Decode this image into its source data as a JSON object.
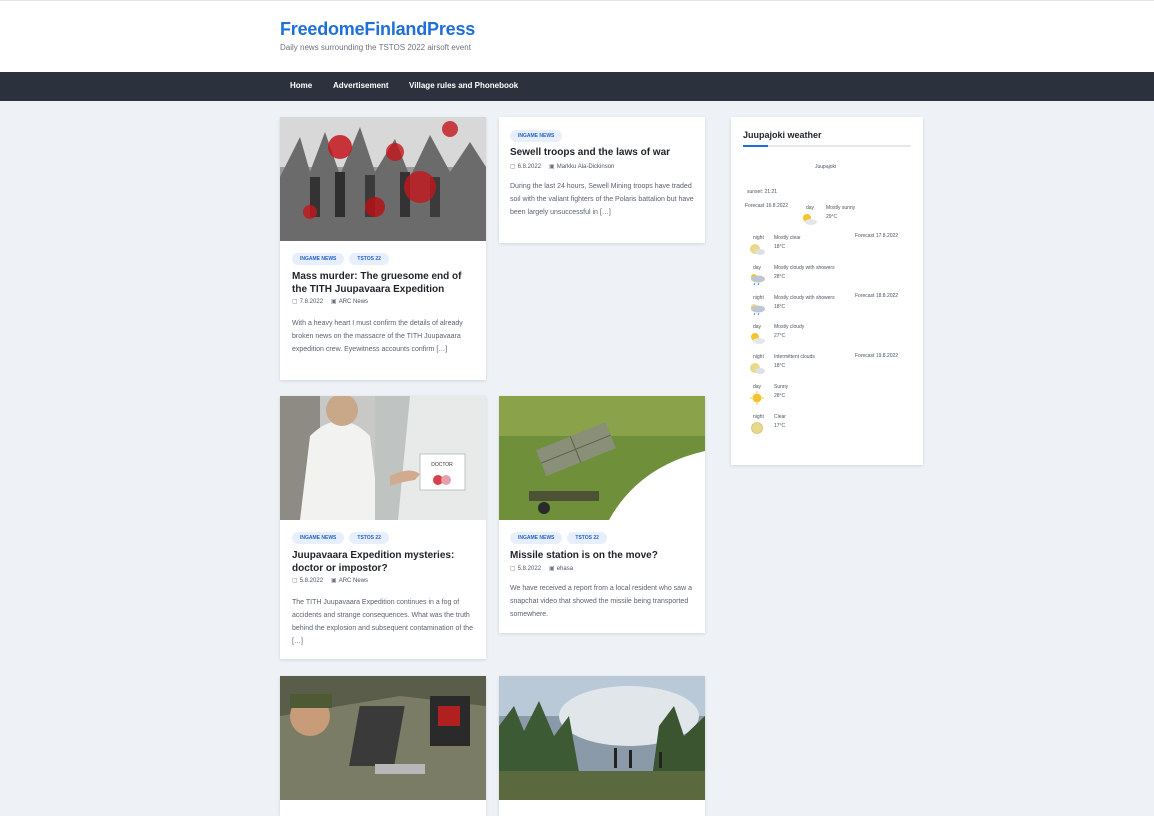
{
  "site": {
    "title": "FreedomeFinlandPress",
    "description": "Daily news surrounding the TSTOS 2022 airsoft event"
  },
  "menu": [
    "Home",
    "Advertisement",
    "Village rules and Phonebook"
  ],
  "posts": [
    {
      "tags": [
        "INGAME NEWS",
        "TSTOS 22"
      ],
      "title": "Mass murder: The gruesome end of the TITH Juupavaara Expedition",
      "date": "7.8.2022",
      "author": "ARC News",
      "excerpt": "With a heavy heart I must confirm the details of already broken news on the massacre of the TITH Juupavaara expedition crew. Eyewitness accounts confirm […]"
    },
    {
      "tags": [
        "INGAME NEWS"
      ],
      "title": "Sewell troops and the laws of war",
      "date": "6.8.2022",
      "author": "Markku Ala-Dickinson",
      "excerpt": "During the last 24 hours, Sewell Mining troops have traded soil with the valiant fighters of the Polaris battalion but have been largely unsuccessful in […]"
    },
    {
      "tags": [
        "INGAME NEWS",
        "TSTOS 22"
      ],
      "title": "Juupavaara Expedition mysteries: doctor or impostor?",
      "date": "5.8.2022",
      "author": "ARC News",
      "excerpt": "The TITH Juupavaara Expedition continues in a fog of accidents and strange consequences. What was the truth behind the explosion and subsequent contamination of the […]",
      "image_text": "DOCTOR"
    },
    {
      "tags": [
        "INGAME NEWS",
        "TSTOS 22"
      ],
      "title": "Missile station is on the move?",
      "date": "5.8.2022",
      "author": "ehasa",
      "excerpt": "We have received a report from a local resident who saw a snapchat video that showed the missile being transported somewhere."
    }
  ],
  "weather": {
    "title": "Juupajoki weather",
    "location": "Juupajoki",
    "sunset": "sunset: 21:21",
    "forecast_labels": [
      "Forecast 16.8.2022",
      "Forecast 17.8.2022",
      "Forecast 18.8.2022",
      "Forecast 19.8.2022"
    ],
    "entries": [
      {
        "period": "day",
        "desc": "Mostly sunny",
        "temp": "29°C",
        "icon": "sun-cloud-icon"
      },
      {
        "period": "night",
        "desc": "Mostly clear",
        "temp": "18°C",
        "icon": "moon-cloud-icon"
      },
      {
        "period": "day",
        "desc": "Mostly cloudy with showers",
        "temp": "28°C",
        "icon": "rain-cloud-icon"
      },
      {
        "period": "night",
        "desc": "Mostly cloudy with showers",
        "temp": "18°C",
        "icon": "rain-cloud-icon"
      },
      {
        "period": "day",
        "desc": "Mostly cloudy",
        "temp": "27°C",
        "icon": "sun-cloud-icon"
      },
      {
        "period": "night",
        "desc": "Intermittent clouds",
        "temp": "18°C",
        "icon": "moon-cloud-icon"
      },
      {
        "period": "day",
        "desc": "Sunny",
        "temp": "28°C",
        "icon": "sun-icon"
      },
      {
        "period": "night",
        "desc": "Clear",
        "temp": "17°C",
        "icon": "moon-icon"
      }
    ]
  },
  "colors": {
    "accent": "#1e6fd9",
    "nav": "#2b323d",
    "background": "#eef2f6"
  }
}
